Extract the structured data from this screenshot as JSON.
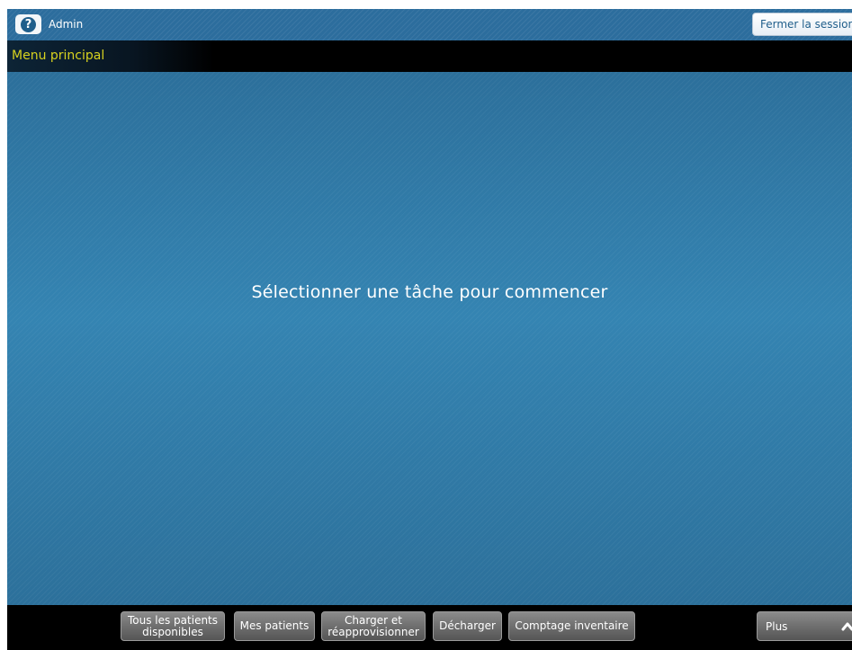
{
  "header": {
    "help_icon_glyph": "?",
    "user_name": "Admin",
    "logout_label": "Fermer la session"
  },
  "title_bar": {
    "title": "Menu principal"
  },
  "main": {
    "prompt": "Sélectionner une tâche pour commencer"
  },
  "toolbar": {
    "buttons": [
      {
        "label": "Tous les patients\ndisponibles"
      },
      {
        "label": "Mes patients"
      },
      {
        "label": "Charger et\nréapprovisionner"
      },
      {
        "label": "Décharger"
      },
      {
        "label": "Comptage inventaire"
      }
    ],
    "more_label": "Plus",
    "more_icon": "chevron-up-icon"
  },
  "colors": {
    "background_blue": "#2f78a4",
    "title_text": "#d7d21f",
    "button_gray": "#6f6f6f",
    "bar_black": "#000000"
  }
}
